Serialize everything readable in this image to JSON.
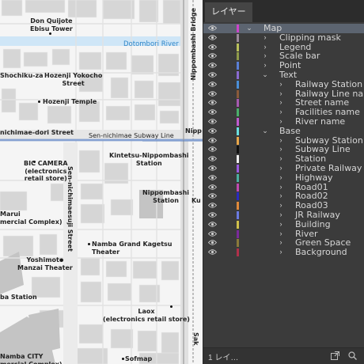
{
  "map": {
    "labels": {
      "don_quijote": "Don Quijote\nEbisu Tower",
      "dotombori_river": "Dotombori River",
      "nippombashi_bridge": "Nippombashi Bridge",
      "shochiku_za": "Shochiku-za",
      "hozenji_yokocho": "Hozenji Yokocho\nStreet",
      "hozenji_temple": "Hozenji Temple",
      "sen_nichimae_dori": "nichimae-dori Street",
      "sen_nichimae_line": "Sen-nichimae Subway Line",
      "nipp_cut": "Nipp",
      "kintetsu_station": "Kintetsu-Nippombashi\nStation",
      "bic_camera": "BIC CAMERA\n(electronics\nretail store)",
      "sennichimae_street": "Sen-nichimaesuji Street",
      "nippombashi_station": "Nippombashi\nStation",
      "ku_cut": "Ku",
      "marui": "Marui\nmercial Complex)",
      "namba_grand_kagetsu": "Namba Grand Kagetsu\nTheater",
      "yoshimoto": "Yoshimoto\nManzai Theater",
      "ba_station": "ba Station",
      "laox": "Laox\n(electronics retail store)",
      "namba_city": "Namba CITY\nmercial Complex)",
      "sofmap": "Sofmap",
      "sak_cut": "Sak"
    }
  },
  "panel": {
    "tab_label": "レイヤー",
    "footer_label": "1 レイ…",
    "layers": [
      {
        "label": "Map",
        "color": "#cc44cc",
        "depth": 0,
        "expander": "down",
        "selected": true
      },
      {
        "label": "Clipping mask",
        "color": "#9a8a9a",
        "depth": 1,
        "expander": "right",
        "selected": false
      },
      {
        "label": "Legend",
        "color": "#b9c05a",
        "depth": 1,
        "expander": "right",
        "selected": false
      },
      {
        "label": "Scale bar",
        "color": "#8f9a4a",
        "depth": 1,
        "expander": "right",
        "selected": false
      },
      {
        "label": "Point",
        "color": "#5a7fd6",
        "depth": 1,
        "expander": "right",
        "selected": false
      },
      {
        "label": "Text",
        "color": "#8a6ad0",
        "depth": 1,
        "expander": "down",
        "selected": false
      },
      {
        "label": "Railway Station",
        "color": "#4a8fd8",
        "depth": 2,
        "expander": "right",
        "selected": false
      },
      {
        "label": "Railway Line name",
        "color": "#8a5a3a",
        "depth": 2,
        "expander": "right",
        "selected": false
      },
      {
        "label": "Street name",
        "color": "#a65ab0",
        "depth": 2,
        "expander": "right",
        "selected": false
      },
      {
        "label": "Facilities name",
        "color": "#4ab06a",
        "depth": 2,
        "expander": "right",
        "selected": false
      },
      {
        "label": "River name",
        "color": "#c05ad0",
        "depth": 2,
        "expander": "right",
        "selected": false
      },
      {
        "label": "Base",
        "color": "#6ae0e0",
        "depth": 1,
        "expander": "down",
        "selected": false
      },
      {
        "label": "Subway Station",
        "color": "#e8a64a",
        "depth": 2,
        "expander": "right",
        "selected": false
      },
      {
        "label": "Subway Line",
        "color": "#111111",
        "depth": 2,
        "expander": "right",
        "selected": false
      },
      {
        "label": "Station",
        "color": "#f0f0f0",
        "depth": 2,
        "expander": "right",
        "selected": false
      },
      {
        "label": "Private Railway",
        "color": "#9a5ae0",
        "depth": 2,
        "expander": "right",
        "selected": false
      },
      {
        "label": "Highway",
        "color": "#4ab0a0",
        "depth": 2,
        "expander": "right",
        "selected": false
      },
      {
        "label": "Road01",
        "color": "#c04ab0",
        "depth": 2,
        "expander": "right",
        "selected": false
      },
      {
        "label": "Road02",
        "color": "#2a2ac0",
        "depth": 2,
        "expander": "right",
        "selected": false
      },
      {
        "label": "Road03",
        "color": "#e08a3a",
        "depth": 2,
        "expander": "right",
        "selected": false
      },
      {
        "label": "JR Railway",
        "color": "#6a7ae0",
        "depth": 2,
        "expander": "right",
        "selected": false
      },
      {
        "label": "Building",
        "color": "#d0c04a",
        "depth": 2,
        "expander": "right",
        "selected": false
      },
      {
        "label": "River",
        "color": "#7a2a9a",
        "depth": 2,
        "expander": "right",
        "selected": false
      },
      {
        "label": "Green Space",
        "color": "#8a7a3a",
        "depth": 2,
        "expander": "right",
        "selected": false
      },
      {
        "label": "Background",
        "color": "#b0304a",
        "depth": 2,
        "expander": "right",
        "selected": false
      }
    ]
  }
}
